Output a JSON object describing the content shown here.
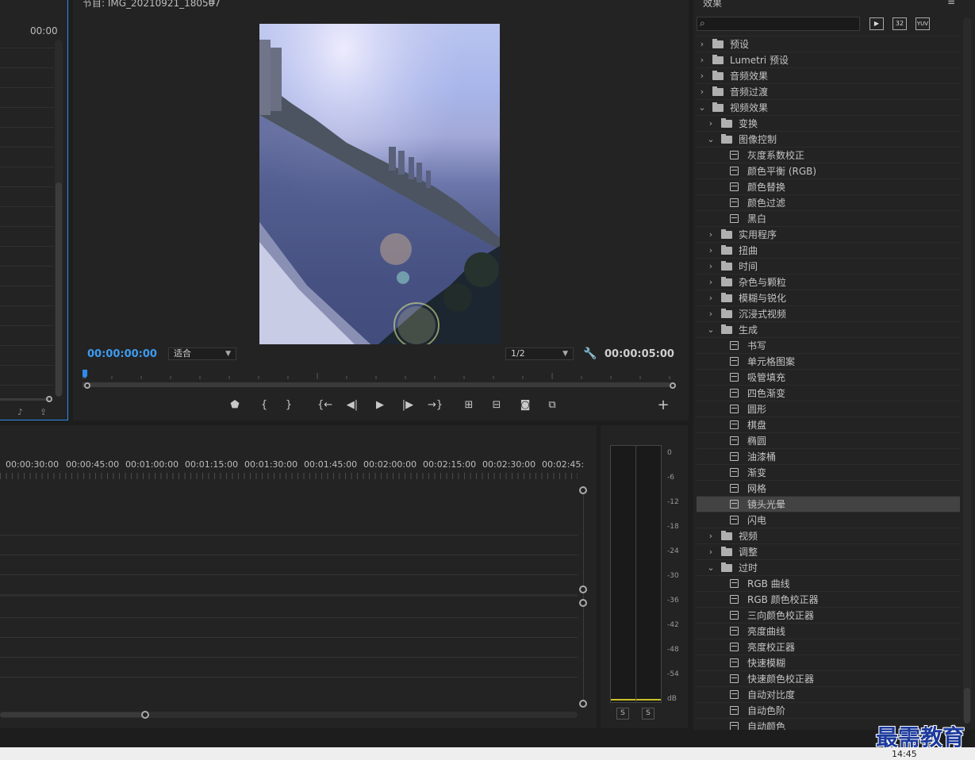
{
  "project_panel": {
    "timecode": "00:00",
    "icons": [
      "audio-icon",
      "export-icon"
    ]
  },
  "program_monitor": {
    "title": "节目: IMG_20210921_180507",
    "menu_icon": "hamburger-icon",
    "current_time": "00:00:00:00",
    "fit_label": "适合",
    "resolution": "1/2",
    "duration": "00:00:05:00",
    "colors": {
      "accent": "#2d8ceb",
      "timecode_blue": "#3d9bf0"
    },
    "controls": [
      "marker-icon",
      "mark-in-icon",
      "mark-out-icon",
      "go-to-in-icon",
      "step-back-icon",
      "play-icon",
      "step-forward-icon",
      "go-to-out-icon",
      "insert-icon",
      "overwrite-icon",
      "camera-icon",
      "compare-icon",
      "add-icon"
    ]
  },
  "timeline": {
    "ruler_labels": [
      "00:00:30:00",
      "00:00:45:00",
      "00:01:00:00",
      "00:01:15:00",
      "00:01:30:00",
      "00:01:45:00",
      "00:02:00:00",
      "00:02:15:00",
      "00:02:30:00",
      "00:02:45:"
    ]
  },
  "audio_meter": {
    "db_labels": [
      "0",
      "-6",
      "-12",
      "-18",
      "-24",
      "-30",
      "-36",
      "-42",
      "-48",
      "-54",
      "dB"
    ],
    "solo_labels": [
      "S",
      "S"
    ]
  },
  "effects": {
    "title": "效果",
    "search_icon": "search-icon",
    "toolbar_icons": [
      "accelerated-effects-icon",
      "32bit-icon",
      "yuv-icon"
    ],
    "items": [
      {
        "label": "预设",
        "type": "folder-star",
        "level": 0,
        "state": "collapsed"
      },
      {
        "label": "Lumetri 预设",
        "type": "folder-star",
        "level": 0,
        "state": "collapsed"
      },
      {
        "label": "音频效果",
        "type": "folder",
        "level": 0,
        "state": "collapsed"
      },
      {
        "label": "音频过渡",
        "type": "folder",
        "level": 0,
        "state": "collapsed"
      },
      {
        "label": "视频效果",
        "type": "folder",
        "level": 0,
        "state": "expanded"
      },
      {
        "label": "变换",
        "type": "folder",
        "level": 1,
        "state": "collapsed"
      },
      {
        "label": "图像控制",
        "type": "folder",
        "level": 1,
        "state": "expanded"
      },
      {
        "label": "灰度系数校正",
        "type": "effect",
        "level": 2
      },
      {
        "label": "颜色平衡 (RGB)",
        "type": "effect",
        "level": 2
      },
      {
        "label": "颜色替换",
        "type": "effect",
        "level": 2
      },
      {
        "label": "颜色过滤",
        "type": "effect",
        "level": 2
      },
      {
        "label": "黑白",
        "type": "effect",
        "level": 2
      },
      {
        "label": "实用程序",
        "type": "folder",
        "level": 1,
        "state": "collapsed"
      },
      {
        "label": "扭曲",
        "type": "folder",
        "level": 1,
        "state": "collapsed"
      },
      {
        "label": "时间",
        "type": "folder",
        "level": 1,
        "state": "collapsed"
      },
      {
        "label": "杂色与颗粒",
        "type": "folder",
        "level": 1,
        "state": "collapsed"
      },
      {
        "label": "模糊与锐化",
        "type": "folder",
        "level": 1,
        "state": "collapsed"
      },
      {
        "label": "沉浸式视频",
        "type": "folder",
        "level": 1,
        "state": "collapsed"
      },
      {
        "label": "生成",
        "type": "folder",
        "level": 1,
        "state": "expanded"
      },
      {
        "label": "书写",
        "type": "effect",
        "level": 2
      },
      {
        "label": "单元格图案",
        "type": "effect",
        "level": 2
      },
      {
        "label": "吸管填充",
        "type": "effect",
        "level": 2
      },
      {
        "label": "四色渐变",
        "type": "effect",
        "level": 2
      },
      {
        "label": "圆形",
        "type": "effect",
        "level": 2
      },
      {
        "label": "棋盘",
        "type": "effect",
        "level": 2
      },
      {
        "label": "椭圆",
        "type": "effect",
        "level": 2
      },
      {
        "label": "油漆桶",
        "type": "effect",
        "level": 2
      },
      {
        "label": "渐变",
        "type": "effect",
        "level": 2
      },
      {
        "label": "网格",
        "type": "effect",
        "level": 2
      },
      {
        "label": "镜头光晕",
        "type": "effect",
        "level": 2,
        "selected": true
      },
      {
        "label": "闪电",
        "type": "effect",
        "level": 2
      },
      {
        "label": "视频",
        "type": "folder",
        "level": 1,
        "state": "collapsed"
      },
      {
        "label": "调整",
        "type": "folder",
        "level": 1,
        "state": "collapsed"
      },
      {
        "label": "过时",
        "type": "folder",
        "level": 1,
        "state": "expanded"
      },
      {
        "label": "RGB 曲线",
        "type": "effect",
        "level": 2
      },
      {
        "label": "RGB 颜色校正器",
        "type": "effect",
        "level": 2
      },
      {
        "label": "三向颜色校正器",
        "type": "effect",
        "level": 2
      },
      {
        "label": "亮度曲线",
        "type": "effect",
        "level": 2
      },
      {
        "label": "亮度校正器",
        "type": "effect",
        "level": 2
      },
      {
        "label": "快速模糊",
        "type": "effect",
        "level": 2
      },
      {
        "label": "快速颜色校正器",
        "type": "effect",
        "level": 2
      },
      {
        "label": "自动对比度",
        "type": "effect",
        "level": 2
      },
      {
        "label": "自动色阶",
        "type": "effect",
        "level": 2
      },
      {
        "label": "自动颜色",
        "type": "effect",
        "level": 2
      }
    ]
  },
  "taskbar": {
    "clock": "14:45",
    "watermark": "最需教育"
  }
}
